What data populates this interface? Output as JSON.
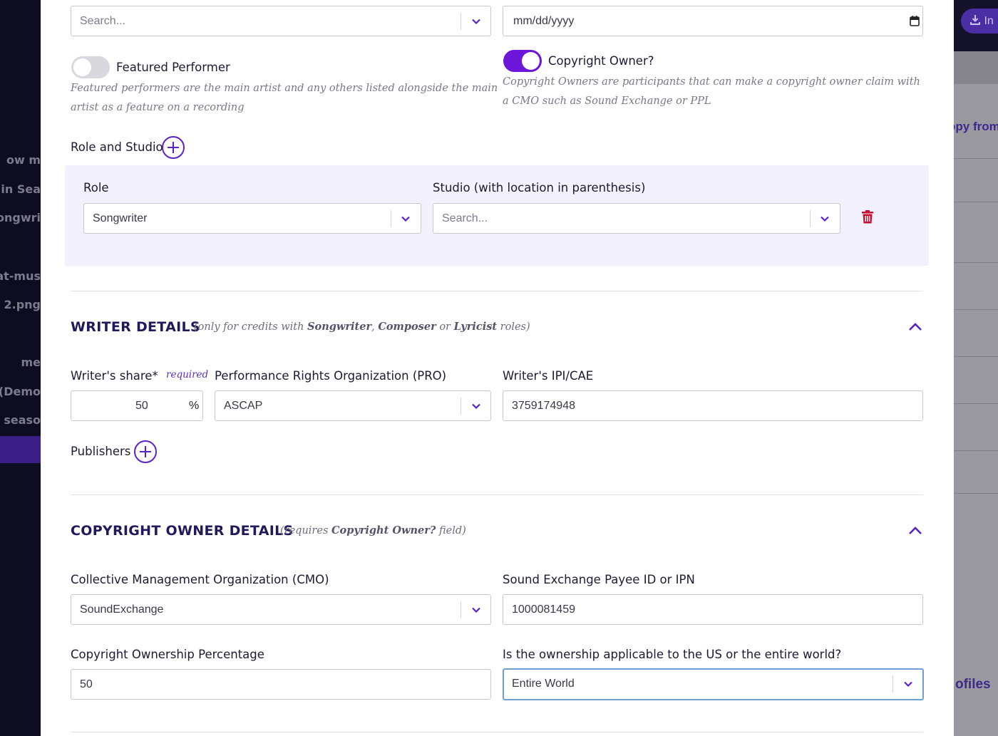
{
  "background": {
    "left_items": [
      "ow m",
      "t in Sea",
      "Songwri",
      "eat-mus",
      "2.png",
      "me",
      "s (Demo",
      "he seaso"
    ],
    "right_button": "In",
    "right_link": "opy from",
    "right_bottom": "ofiles"
  },
  "top": {
    "search_placeholder": "Search...",
    "date_placeholder": "mm/dd/yyyy"
  },
  "featured_performer": {
    "label": "Featured Performer",
    "enabled": false,
    "help": "Featured performers are the main artist and any others listed alongside the main artist as a feature on a recording"
  },
  "copyright_owner": {
    "label": "Copyright Owner?",
    "enabled": true,
    "help": "Copyright Owners are participants that can make a copyright owner claim with a CMO such as Sound Exchange or PPL"
  },
  "role_studio": {
    "heading": "Role and Studio",
    "role_label": "Role",
    "role_value": "Songwriter",
    "studio_label": "Studio (with location in parenthesis)",
    "studio_placeholder": "Search..."
  },
  "writer_details": {
    "title": "WRITER DETAILS",
    "note_pre": "(only for credits with ",
    "note_r1": "Songwriter",
    "note_sep1": ", ",
    "note_r2": "Composer",
    "note_sep2": " or ",
    "note_r3": "Lyricist",
    "note_post": " roles)",
    "share_label": "Writer's share*",
    "required": "required",
    "share_value": "50",
    "share_unit": "%",
    "pro_label": "Performance Rights Organization (PRO)",
    "pro_value": "ASCAP",
    "ipi_label": "Writer's IPI/CAE",
    "ipi_value": "3759174948",
    "publishers_label": "Publishers"
  },
  "copyright_details": {
    "title": "COPYRIGHT OWNER DETAILS",
    "note_pre": "(requires ",
    "note_bold": "Copyright Owner?",
    "note_post": " field)",
    "cmo_label": "Collective Management Organization (CMO)",
    "cmo_value": "SoundExchange",
    "payee_label": "Sound Exchange Payee ID or IPN",
    "payee_value": "1000081459",
    "percentage_label": "Copyright Ownership Percentage",
    "percentage_value": "50",
    "territory_label": "Is the ownership applicable to the US or the entire world?",
    "territory_value": "Entire World"
  },
  "colors": {
    "accent": "#6b16d8",
    "section_title": "#1f1a5c",
    "delete": "#c8102e"
  }
}
